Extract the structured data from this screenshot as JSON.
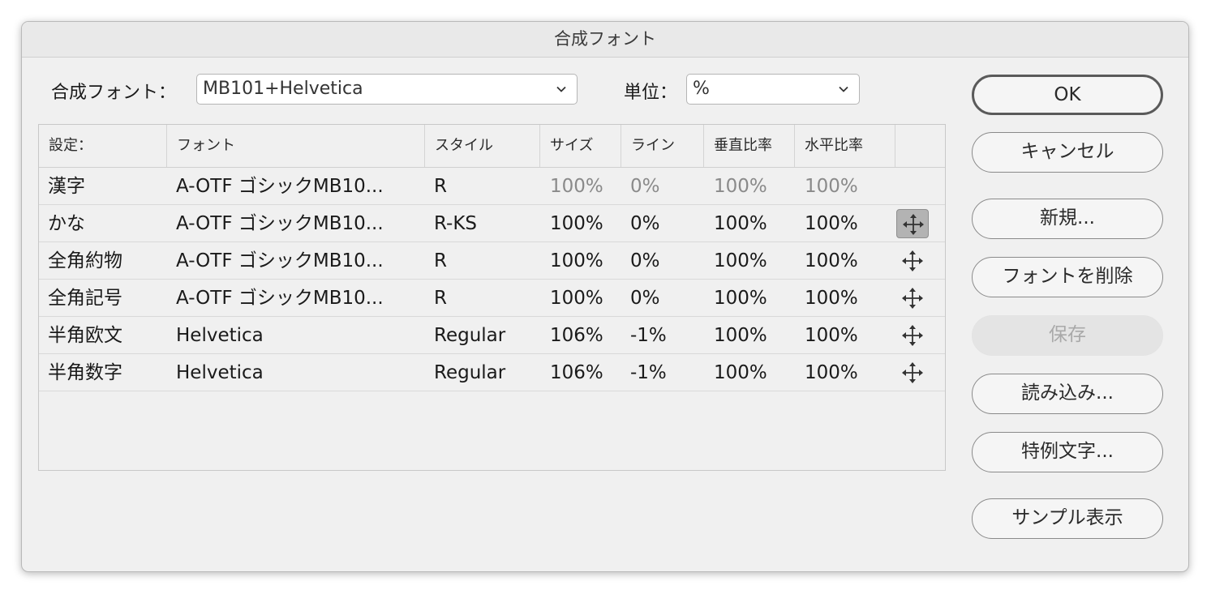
{
  "title": "合成フォント",
  "font_label": "合成フォント：",
  "font_select": "MB101+Helvetica",
  "unit_label": "単位：",
  "unit_select": "%",
  "columns": [
    "設定：",
    "フォント",
    "スタイル",
    "サイズ",
    "ライン",
    "垂直比率",
    "水平比率"
  ],
  "rows": [
    {
      "setting": "漢字",
      "font": "A-OTF ゴシックMB10...",
      "style": "R",
      "size": "100%",
      "line": "0%",
      "vscale": "100%",
      "hscale": "100%"
    },
    {
      "setting": "かな",
      "font": "A-OTF ゴシックMB10...",
      "style": "R-KS",
      "size": "100%",
      "line": "0%",
      "vscale": "100%",
      "hscale": "100%"
    },
    {
      "setting": "全角約物",
      "font": "A-OTF ゴシックMB10...",
      "style": "R",
      "size": "100%",
      "line": "0%",
      "vscale": "100%",
      "hscale": "100%"
    },
    {
      "setting": "全角記号",
      "font": "A-OTF ゴシックMB10...",
      "style": "R",
      "size": "100%",
      "line": "0%",
      "vscale": "100%",
      "hscale": "100%"
    },
    {
      "setting": "半角欧文",
      "font": "Helvetica",
      "style": "Regular",
      "size": "106%",
      "line": "-1%",
      "vscale": "100%",
      "hscale": "100%"
    },
    {
      "setting": "半角数字",
      "font": "Helvetica",
      "style": "Regular",
      "size": "106%",
      "line": "-1%",
      "vscale": "100%",
      "hscale": "100%"
    }
  ],
  "buttons": {
    "ok": "OK",
    "cancel": "キャンセル",
    "new": "新規...",
    "delete_font": "フォントを削除",
    "save": "保存",
    "load": "読み込み...",
    "exceptions": "特例文字...",
    "sample": "サンプル表示"
  },
  "icons": {
    "move": "move-arrows-icon",
    "chevron": "chevron-down-icon"
  },
  "colors": {
    "dialog_bg": "#f0f0f0",
    "dim_text": "#8a8a8a",
    "selected_handle": "#b3b3b3"
  }
}
